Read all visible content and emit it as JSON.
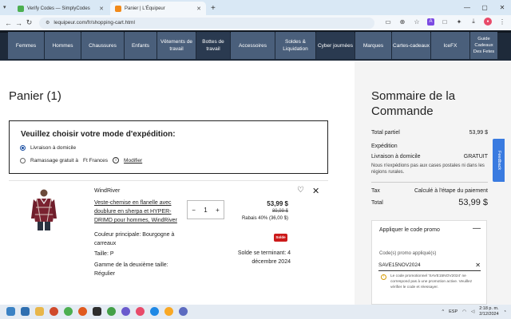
{
  "browser": {
    "tabs": [
      {
        "title": "Verify Codes — SimplyCodes",
        "active": false,
        "favicon_color": "#4caf50"
      },
      {
        "title": "Panier | L'Équipeur",
        "active": true,
        "favicon_color": "#f28a1a"
      }
    ],
    "new_tab_icon": "plus-icon",
    "url": "lequipeur.com/fr/shopping-cart.html",
    "window_controls": [
      "minimize-icon",
      "maximize-icon",
      "close-icon"
    ]
  },
  "site_nav": {
    "items": [
      "Femmes",
      "Hommes",
      "Chaussures",
      "Enfants",
      "Vêtements de travail",
      "Bottes de travail",
      "Accessoires",
      "Soldes & Liquidation",
      "Cyber journées",
      "Marques",
      "Cartes-cadeaux",
      "IceFX",
      "Guide Cadeaux Des Fetes"
    ]
  },
  "cart": {
    "title": "Panier (1)",
    "shipping": {
      "question": "Veuillez choisir votre mode d'expédition:",
      "option_home": "Livraison à domicile",
      "option_pickup": "Ramassage gratuit à",
      "pickup_store": "Ft Frances",
      "modify_label": "Modifier",
      "selected": "home"
    },
    "item": {
      "brand": "WindRiver",
      "name": "Veste-chemise en flanelle avec doublure en sherpa et HYPER-DRIMD pour hommes, WindRiver",
      "quantity": "1",
      "price": "53,99 $",
      "old_price": "89,99 $",
      "discount": "Rabais 40% (36,00 $)",
      "color": "Couleur principale: Bourgogne à carreaux",
      "size": "Taille: P",
      "second_size": "Gamme de la deuxième taille: Régulier",
      "badge": "Solde",
      "sale_end": "Solde se terminant: 4 décembre 2024"
    }
  },
  "summary": {
    "title": "Sommaire de la Commande",
    "subtotal_label": "Total partiel",
    "subtotal_value": "53,99 $",
    "shipping_label": "Expédition",
    "shipping_method": "Livraison à domicile",
    "shipping_value": "GRATUIT",
    "shipping_note": "Nous n'expédions pas aux cases postales ni dans les régions rurales.",
    "tax_label": "Tax",
    "tax_value": "Calculé à l'étape du paiement",
    "total_label": "Total",
    "total_value": "53,99 $",
    "promo": {
      "heading": "Appliquer le code promo",
      "applied_label": "Code(s) promo appliqué(s)",
      "code": "SAVE15NOV2024",
      "message": "Le code promotionnel 'SAVE15NOV2024' ne correspond pas à une promotion active. Veuillez vérifier le code et réessayer."
    },
    "feedback_label": "Feedback"
  },
  "taskbar": {
    "lang": "ESP",
    "time": "2:18 p. m.",
    "date": "2/12/2024"
  }
}
